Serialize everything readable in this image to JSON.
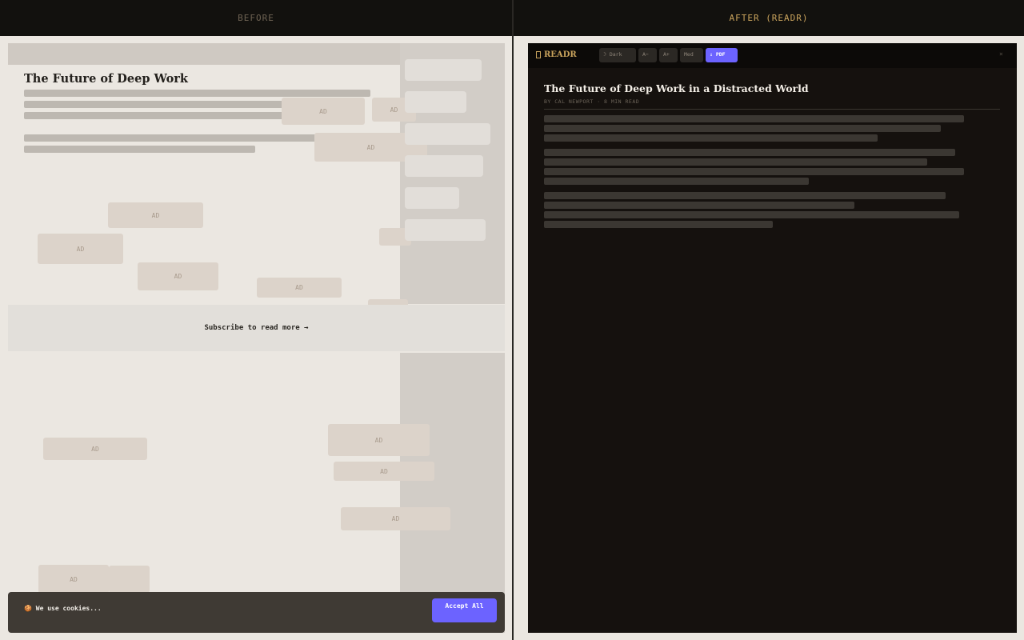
{
  "header": {
    "before_label": "BEFORE",
    "after_label": "AFTER (READR)"
  },
  "before": {
    "title": "The Future of Deep Work",
    "ad_label": "AD",
    "subscribe_text": "Subscribe to read more →",
    "cookie_icon": "cookie-icon",
    "cookie_text": "🍪 We use cookies...",
    "accept_label": "Accept All"
  },
  "after": {
    "logo_text": "READR",
    "toolbar": {
      "dark_label": "☽ Dark",
      "font_smaller_label": "A−",
      "font_larger_label": "A+",
      "width_label": "Med",
      "pdf_label": "⇓ PDF"
    },
    "close_label": "×",
    "title": "The Future of Deep Work in a Distracted World",
    "meta": "BY CAL NEWPORT · 8 MIN READ"
  },
  "colors": {
    "accent": "#6c63ff",
    "gold": "#c9a35c",
    "dark_bg": "#15110e"
  }
}
